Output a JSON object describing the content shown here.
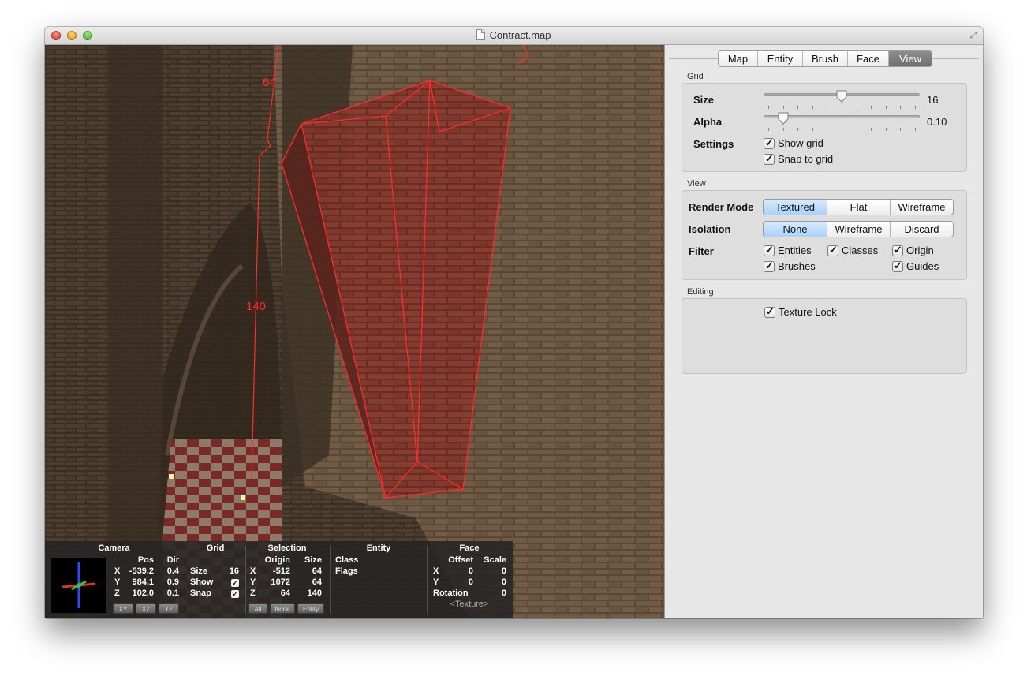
{
  "window": {
    "title": "Contract.map"
  },
  "viewport": {
    "measurements": {
      "height_top": "64",
      "height_main": "140"
    }
  },
  "status": {
    "camera": {
      "title": "Camera",
      "col_pos": "Pos",
      "col_dir": "Dir",
      "rows": [
        {
          "axis": "X",
          "pos": "-539.2",
          "dir": "0.4"
        },
        {
          "axis": "Y",
          "pos": "984.1",
          "dir": "0.9"
        },
        {
          "axis": "Z",
          "pos": "102.0",
          "dir": "0.1"
        }
      ],
      "buttons": [
        "XY",
        "XZ",
        "YZ"
      ]
    },
    "grid": {
      "title": "Grid",
      "size_label": "Size",
      "size_value": "16",
      "show_label": "Show",
      "snap_label": "Snap"
    },
    "selection": {
      "title": "Selection",
      "col_origin": "Origin",
      "col_size": "Size",
      "rows": [
        {
          "axis": "X",
          "origin": "-512",
          "size": "64"
        },
        {
          "axis": "Y",
          "origin": "1072",
          "size": "64"
        },
        {
          "axis": "Z",
          "origin": "64",
          "size": "140"
        }
      ],
      "buttons": [
        "All",
        "None",
        "Entity"
      ]
    },
    "entity": {
      "title": "Entity",
      "class_label": "Class",
      "flags_label": "Flags"
    },
    "face": {
      "title": "Face",
      "col_offset": "Offset",
      "col_scale": "Scale",
      "rows": [
        {
          "axis": "X",
          "offset": "0",
          "scale": "0"
        },
        {
          "axis": "Y",
          "offset": "0",
          "scale": "0"
        }
      ],
      "rotation_label": "Rotation",
      "rotation_value": "0",
      "texture": "<Texture>"
    }
  },
  "inspector": {
    "tabs": [
      "Map",
      "Entity",
      "Brush",
      "Face",
      "View"
    ],
    "active_tab": "View",
    "grid": {
      "title": "Grid",
      "size_label": "Size",
      "size_value": "16",
      "size_fraction": 0.5,
      "alpha_label": "Alpha",
      "alpha_value": "0.10",
      "alpha_fraction": 0.1,
      "settings_label": "Settings",
      "show_grid": "Show grid",
      "snap_to_grid": "Snap to grid"
    },
    "view": {
      "title": "View",
      "render_mode_label": "Render Mode",
      "render_modes": [
        "Textured",
        "Flat",
        "Wireframe"
      ],
      "render_mode_selected": "Textured",
      "isolation_label": "Isolation",
      "isolation_modes": [
        "None",
        "Wireframe",
        "Discard"
      ],
      "isolation_selected": "None",
      "filter_label": "Filter",
      "filters": {
        "entities": "Entities",
        "classes": "Classes",
        "origin": "Origin",
        "brushes": "Brushes",
        "guides": "Guides"
      }
    },
    "editing": {
      "title": "Editing",
      "texture_lock": "Texture Lock"
    }
  },
  "colors": {
    "selection": "#ff2a2a",
    "accent_selected": "#a9d1fb",
    "active_tab": "#7c7c7c"
  }
}
